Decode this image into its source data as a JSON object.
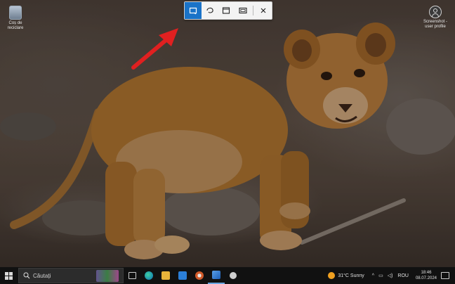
{
  "desktop": {
    "icons": [
      {
        "label": "Coș de reciclare",
        "icon": "recycle-bin-icon"
      },
      {
        "label": "Screenshot - user profile",
        "icon": "user-profile-icon"
      }
    ]
  },
  "snip_toolbar": {
    "modes": [
      {
        "name": "rectangle",
        "icon": "rectangle-snip-icon",
        "active": true
      },
      {
        "name": "freeform",
        "icon": "freeform-snip-icon",
        "active": false
      },
      {
        "name": "window",
        "icon": "window-snip-icon",
        "active": false
      },
      {
        "name": "fullscreen",
        "icon": "fullscreen-snip-icon",
        "active": false
      }
    ],
    "close_icon": "close-icon",
    "active_color": "#1a73c8"
  },
  "annotation": {
    "color": "#e02020",
    "icon": "red-arrow-icon"
  },
  "taskbar": {
    "search_placeholder": "Căutați",
    "apps": [
      "task-view-icon",
      "edge-icon",
      "file-explorer-icon",
      "store-icon",
      "media-player-icon",
      "snipping-tool-icon",
      "teams-icon"
    ],
    "weather": {
      "temp": "31°C",
      "condition": "Sunny"
    },
    "language": "ROU",
    "time": "18:46",
    "date": "08.07.2024"
  }
}
